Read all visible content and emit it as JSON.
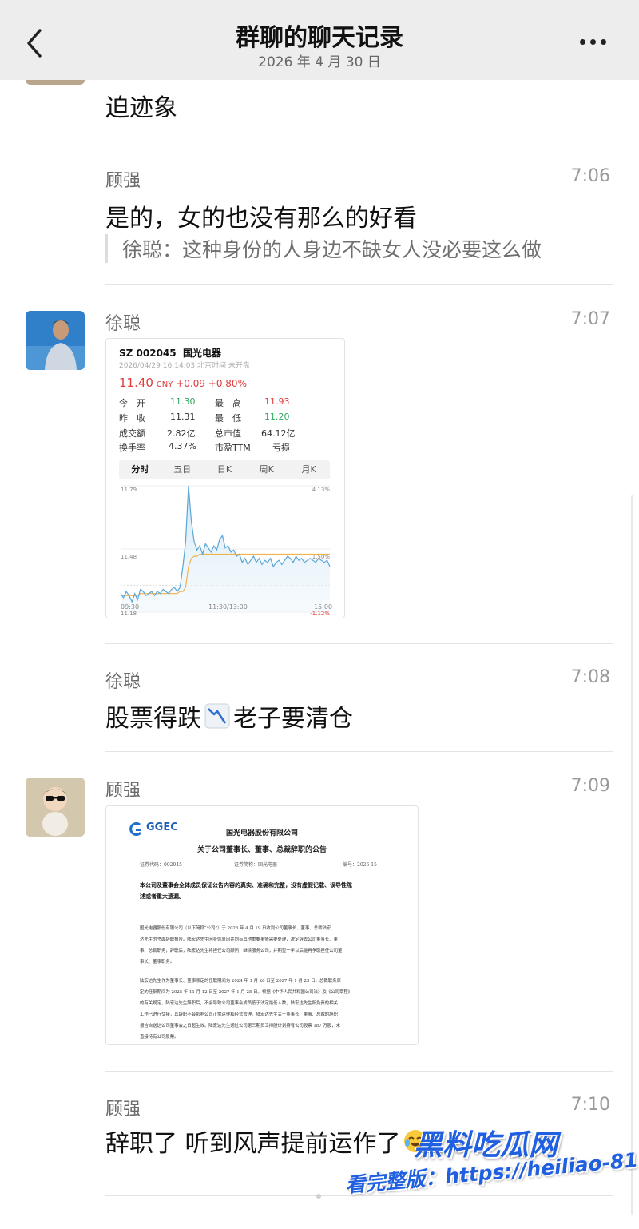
{
  "header": {
    "title": "群聊的聊天记录",
    "date": "2026 年 4 月 30 日"
  },
  "messages": {
    "m0": {
      "text": "迫迹象"
    },
    "m1": {
      "sender": "顾强",
      "time": "7:06",
      "text": "是的，女的也没有那么的好看",
      "quote": "徐聪：这种身份的人身边不缺女人没必要这么做"
    },
    "m2": {
      "sender": "徐聪",
      "time": "7:07"
    },
    "m3": {
      "sender": "徐聪",
      "time": "7:08",
      "text_a": "股票得跌",
      "text_b": "老子要清仓"
    },
    "m4": {
      "sender": "顾强",
      "time": "7:09"
    },
    "m5": {
      "sender": "顾强",
      "time": "7:10",
      "text": "辞职了 听到风声提前运作了"
    }
  },
  "stock": {
    "code": "SZ 002045",
    "name": "国光电器",
    "datetime": "2026/04/29 16:14:03 北京时间 未开盘",
    "price": "11.40",
    "currency": "CNY",
    "change": "+0.09",
    "change_pct": "+0.80%",
    "stats": [
      {
        "l1": "今　开",
        "v1": "11.30",
        "l2": "最　高",
        "v2": "11.93"
      },
      {
        "l1": "昨　收",
        "v1": "11.31",
        "l2": "最　低",
        "v2": "11.20"
      },
      {
        "l1": "成交额",
        "v1": "2.82亿",
        "l2": "总市值",
        "v2": "64.12亿"
      },
      {
        "l1": "换手率",
        "v1": "4.37%",
        "l2": "市盈TTM",
        "v2": "亏损"
      }
    ],
    "tabs": [
      "分时",
      "五日",
      "日K",
      "周K",
      "月K"
    ],
    "active_tab": "分时"
  },
  "chart_data": {
    "type": "line",
    "title": "",
    "xlabel": "",
    "ylabel": "",
    "y_left_ticks": [
      "11.79",
      "11.48",
      "11.18"
    ],
    "y_right_ticks": [
      "4.13%",
      "1.50%",
      "-1.12%"
    ],
    "x_ticks": [
      "09:30",
      "11:30/13:00",
      "15:00"
    ],
    "ylim": [
      11.18,
      11.79
    ],
    "reference": 11.31,
    "series": [
      {
        "values": [
          11.27,
          11.25,
          11.28,
          11.26,
          11.23,
          11.27,
          11.24,
          11.29,
          11.28,
          11.26,
          11.27,
          11.28,
          11.26,
          11.28,
          11.27,
          11.29,
          11.28,
          11.27,
          11.29,
          11.3,
          11.28,
          11.3,
          11.4,
          11.52,
          11.79,
          11.62,
          11.52,
          11.48,
          11.5,
          11.46,
          11.51,
          11.49,
          11.47,
          11.5,
          11.48,
          11.53,
          11.55,
          11.49,
          11.5,
          11.47,
          11.48,
          11.45,
          11.46,
          11.42,
          11.44,
          11.41,
          11.43,
          11.45,
          11.42,
          11.44,
          11.41,
          11.43,
          11.42,
          11.44,
          11.4,
          11.42,
          11.43,
          11.41,
          11.43,
          11.45,
          11.44,
          11.42,
          11.45,
          11.43,
          11.44,
          11.42,
          11.43,
          11.44,
          11.43,
          11.42,
          11.44,
          11.43,
          11.42,
          11.43,
          11.4
        ]
      },
      {
        "values": [
          11.26,
          11.26,
          11.26,
          11.26,
          11.26,
          11.26,
          11.26,
          11.27,
          11.27,
          11.27,
          11.27,
          11.27,
          11.27,
          11.27,
          11.27,
          11.27,
          11.27,
          11.27,
          11.27,
          11.27,
          11.27,
          11.28,
          11.28,
          11.3,
          11.4,
          11.44,
          11.45,
          11.45,
          11.46,
          11.46,
          11.46,
          11.46,
          11.46,
          11.46,
          11.46,
          11.46,
          11.46,
          11.46,
          11.46,
          11.46,
          11.46,
          11.46,
          11.46,
          11.46,
          11.46,
          11.46,
          11.46,
          11.46,
          11.46,
          11.46,
          11.46,
          11.46,
          11.46,
          11.46,
          11.46,
          11.46,
          11.46,
          11.46,
          11.46,
          11.46,
          11.46,
          11.46,
          11.46,
          11.46,
          11.46,
          11.46,
          11.46,
          11.46,
          11.46,
          11.46,
          11.46,
          11.46,
          11.46,
          11.46,
          11.46
        ]
      }
    ]
  },
  "doc": {
    "logo": "GGEC",
    "company": "国光电器股份有限公司",
    "title": "关于公司董事长、董事、总裁辞职的公告",
    "code_label": "证券代码：002045",
    "abbr_label": "证券简称：国光电器",
    "num_label": "编号：2026-15",
    "bold_lines": [
      "本公司及董事会全体成员保证公告内容的真实、准确和完整，没有虚假记载、误导性陈",
      "述或者重大遗漏。"
    ],
    "para1": [
      "国光电器股份有限公司（以下简称“公司”）于 2026 年 4 月 19 日收到公司董事长、董事、总裁陆宏",
      "达先生的书面辞职报告。陆宏达先生因身体原因并向有其他重要事情需要处理，决定辞去公司董事长、董",
      "事、总裁职务，辞职后，陆宏达先生将担任公司顾问，继续服务公司，并期望一年以后能再争取担任公司董",
      "事长、董事职务。"
    ],
    "para2": [
      "陆宏达先生作为董事长、董事原定的任职期间为 2024 年 1 月 26 日至 2027 年 1 月 25 日，总裁职务原",
      "定的任职期间为 2025 年 11 月 12 日至 2027 年 1 月 25 日。根据《中华人民共和国公司法》及《公司章程》",
      "的有关规定，陆宏达先生辞职后，不会导致公司董事会成员低于法定最低人数，陆宏达先生所负责的相关",
      "工作已进行交接，其辞职不会影响公司正常运作和经营管理。陆宏达先生关于董事长、董事、总裁的辞职",
      "报告自送达公司董事会之日起生效。陆宏达先生通过公司第三期员工持股计划持有公司股票 187 万股，未",
      "直接持有公司股票。"
    ]
  },
  "watermark": {
    "brand": "黑料吃瓜网",
    "line": "看完整版：https://heiliao-81.com"
  }
}
